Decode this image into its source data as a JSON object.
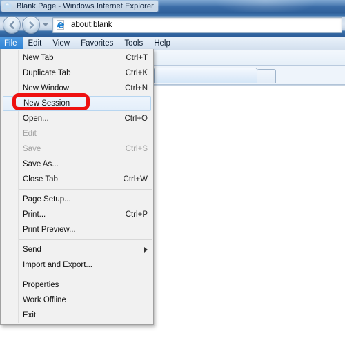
{
  "window": {
    "title": "Blank Page - Windows Internet Explorer",
    "app_icon": "internet-explorer-icon"
  },
  "navbar": {
    "back_label": "Back",
    "forward_label": "Forward",
    "recent_pages_label": "Recent Pages",
    "address": {
      "value": "about:blank",
      "placeholder": "about:blank",
      "favicon": "internet-explorer-icon"
    }
  },
  "menubar": {
    "items": [
      {
        "label": "File",
        "active": true
      },
      {
        "label": "Edit",
        "active": false
      },
      {
        "label": "View",
        "active": false
      },
      {
        "label": "Favorites",
        "active": false
      },
      {
        "label": "Tools",
        "active": false
      },
      {
        "label": "Help",
        "active": false
      }
    ]
  },
  "tabstrip": {
    "tabs": [
      {
        "label": ""
      }
    ],
    "new_tab_label": ""
  },
  "file_menu": {
    "items": [
      {
        "label": "New Tab",
        "accel": "Ctrl+T",
        "disabled": false,
        "submenu": false,
        "highlight": false
      },
      {
        "label": "Duplicate Tab",
        "accel": "Ctrl+K",
        "disabled": false,
        "submenu": false,
        "highlight": false
      },
      {
        "label": "New Window",
        "accel": "Ctrl+N",
        "disabled": false,
        "submenu": false,
        "highlight": false
      },
      {
        "label": "New Session",
        "accel": "",
        "disabled": false,
        "submenu": false,
        "highlight": true
      },
      {
        "label": "Open...",
        "accel": "Ctrl+O",
        "disabled": false,
        "submenu": false,
        "highlight": false
      },
      {
        "label": "Edit",
        "accel": "",
        "disabled": true,
        "submenu": false,
        "highlight": false
      },
      {
        "label": "Save",
        "accel": "Ctrl+S",
        "disabled": true,
        "submenu": false,
        "highlight": false
      },
      {
        "label": "Save As...",
        "accel": "",
        "disabled": false,
        "submenu": false,
        "highlight": false
      },
      {
        "label": "Close Tab",
        "accel": "Ctrl+W",
        "disabled": false,
        "submenu": false,
        "highlight": false
      },
      {
        "separator": true
      },
      {
        "label": "Page Setup...",
        "accel": "",
        "disabled": false,
        "submenu": false,
        "highlight": false
      },
      {
        "label": "Print...",
        "accel": "Ctrl+P",
        "disabled": false,
        "submenu": false,
        "highlight": false
      },
      {
        "label": "Print Preview...",
        "accel": "",
        "disabled": false,
        "submenu": false,
        "highlight": false
      },
      {
        "separator": true
      },
      {
        "label": "Send",
        "accel": "",
        "disabled": false,
        "submenu": true,
        "highlight": false
      },
      {
        "label": "Import and Export...",
        "accel": "",
        "disabled": false,
        "submenu": false,
        "highlight": false
      },
      {
        "separator": true
      },
      {
        "label": "Properties",
        "accel": "",
        "disabled": false,
        "submenu": false,
        "highlight": false
      },
      {
        "label": "Work Offline",
        "accel": "",
        "disabled": false,
        "submenu": false,
        "highlight": false
      },
      {
        "label": "Exit",
        "accel": "",
        "disabled": false,
        "submenu": false,
        "highlight": false
      }
    ]
  },
  "annotation": {
    "target": "New Session",
    "color": "#ee1111",
    "shape": "rounded-rectangle"
  },
  "colors": {
    "titlebar_blue": "#3b6ca6",
    "menu_highlight_blue": "#2e82d4",
    "annotation_red": "#ee1111",
    "menu_background": "#f1f1f1",
    "page_background": "#ffffff"
  }
}
